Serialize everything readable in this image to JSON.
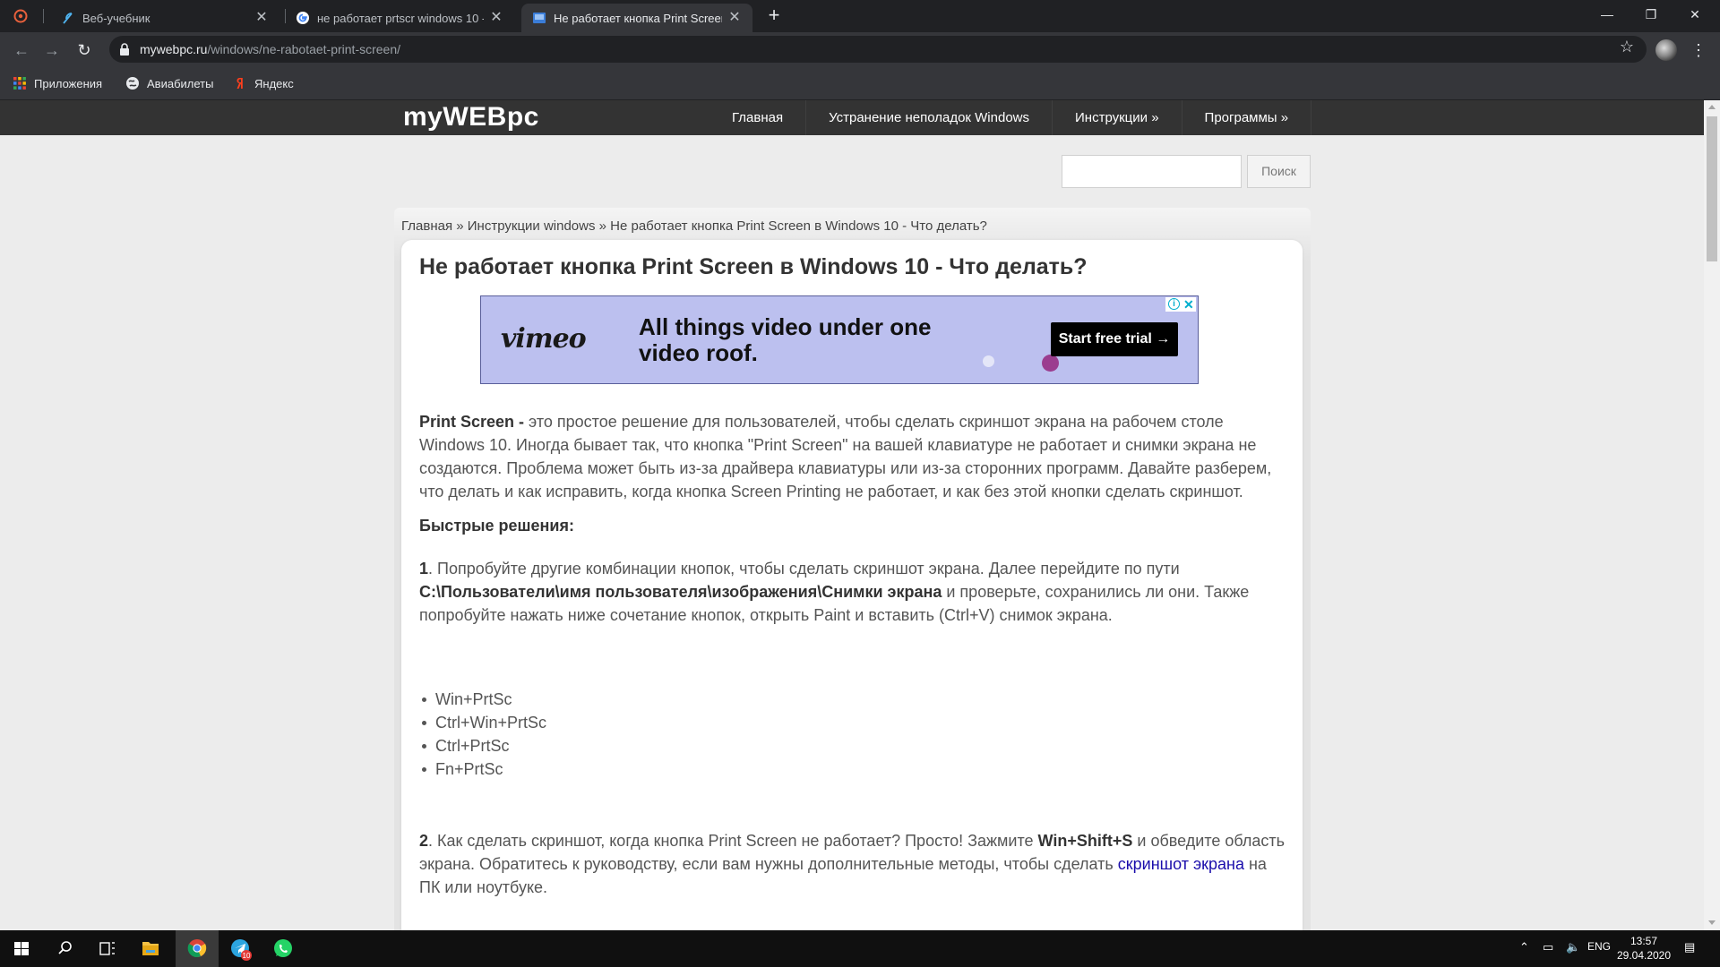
{
  "browser": {
    "tabs": [
      {
        "title": "Веб-учебник",
        "active": false
      },
      {
        "title": "не работает prtscr windows 10 -",
        "active": false
      },
      {
        "title": "Не работает кнопка Print Screen",
        "active": true
      }
    ],
    "url_host": "mywebpc.ru",
    "url_path": "/windows/ne-rabotaet-print-screen/",
    "bookmarks": [
      "Приложения",
      "Авиабилеты",
      "Яндекс"
    ]
  },
  "site": {
    "logo": "myWEBpc",
    "nav": [
      "Главная",
      "Устранение неполадок Windows",
      "Инструкции »",
      "Программы »"
    ],
    "search_button": "Поиск",
    "search_placeholder": ""
  },
  "breadcrumb": "Главная » Инструкции windows » Не работает кнопка Print Screen в Windows 10 - Что делать?",
  "article": {
    "title": "Не работает кнопка Print Screen в Windows 10 - Что делать?",
    "ad": {
      "brand": "vimeo",
      "headline": "All things video under one video roof.",
      "cta": "Start free trial →"
    },
    "intro_bold": "Print Screen -",
    "intro_text": " это простое решение для пользователей, чтобы сделать скриншот экрана на рабочем столе Windows 10. Иногда бывает так, что кнопка \"Print Screen\" на вашей клавиатуре не работает и снимки экрана не создаются. Проблема может быть из-за драйвера клавиатуры или из-за сторонних программ. Давайте разберем, что делать и как исправить, когда кнопка Screen Printing не работает, и как без этой кнопки сделать скриншот.",
    "quick_heading": "Быстрые решения:",
    "step1_num": "1",
    "step1_a": ". Попробуйте другие комбинации кнопок, чтобы сделать скриншот экрана. Далее перейдите по пути ",
    "step1_path": "C:\\Пользователи\\имя пользователя\\изображения\\Снимки экрана",
    "step1_b": " и проверьте, сохранились ли они. Также попробуйте нажать ниже сочетание кнопок, открыть Paint и вставить (Ctrl+V) снимок экрана.",
    "shortcuts": [
      "Win+PrtSc",
      "Ctrl+Win+PrtSc",
      "Ctrl+PrtSc",
      "Fn+PrtSc"
    ],
    "step2_num": "2",
    "step2_a": ". Как сделать скриншот, когда кнопка Print Screen не работает? Просто! Зажмите ",
    "step2_keys": "Win+Shift+S",
    "step2_b": " и обведите область экрана. Обратитесь к руководству, если вам нужны дополнительные методы, чтобы сделать ",
    "step2_link": "скриншот экрана",
    "step2_c": " на ПК или ноутбуке."
  },
  "taskbar": {
    "language": "ENG",
    "time": "13:57",
    "date": "29.04.2020",
    "telegram_badge": "10"
  }
}
